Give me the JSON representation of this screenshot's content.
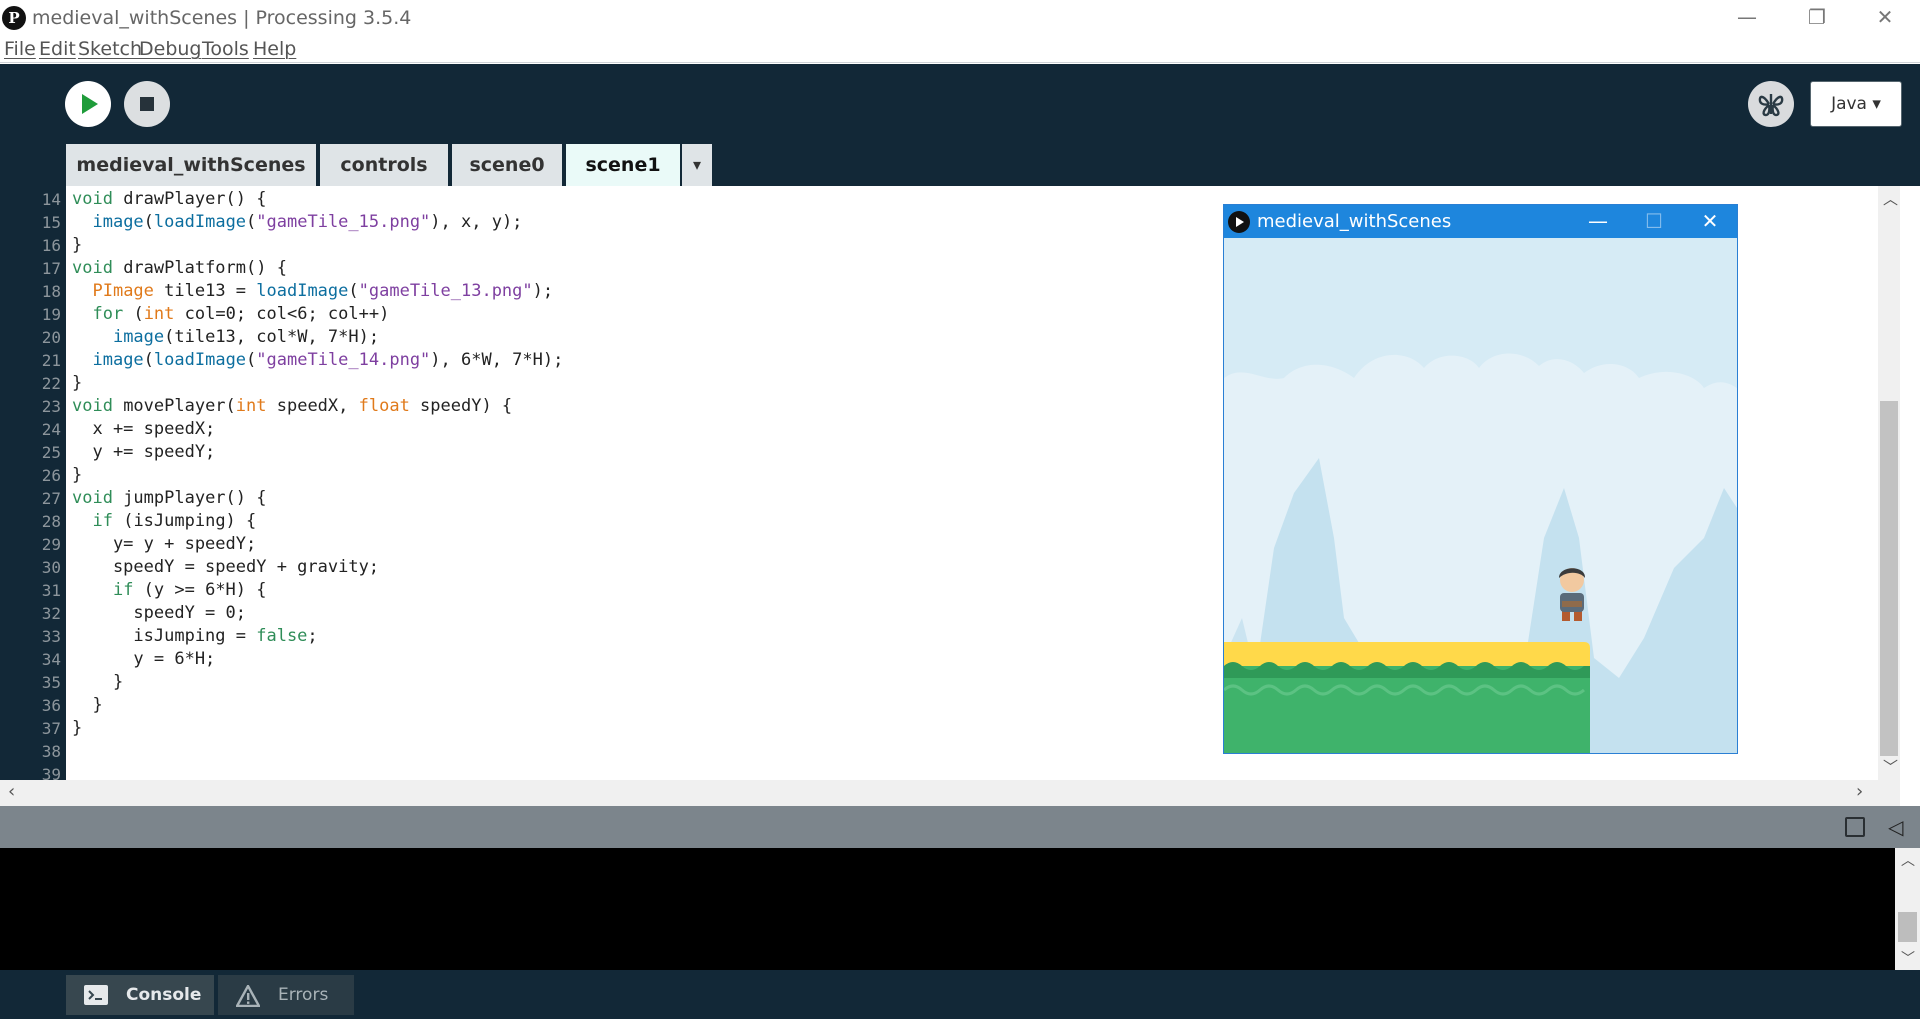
{
  "window": {
    "title": "medieval_withScenes | Processing 3.5.4",
    "app_icon_glyph": "P",
    "controls": {
      "minimize": "—",
      "restore": "❐",
      "close": "✕"
    }
  },
  "menu": [
    "File",
    "Edit",
    "Sketch",
    "Debug",
    "Tools",
    "Help"
  ],
  "toolbar": {
    "mode_label": "Java ▾",
    "debug_icon": "butterfly-icon"
  },
  "tabs": [
    {
      "label": "medieval_withScenes",
      "active": false
    },
    {
      "label": "controls",
      "active": false
    },
    {
      "label": "scene0",
      "active": false
    },
    {
      "label": "scene1",
      "active": true
    }
  ],
  "tab_menu_glyph": "▾",
  "editor": {
    "line_numbers": [
      "14",
      "15",
      "16",
      "17",
      "18",
      "19",
      "20",
      "21",
      "22",
      "23",
      "24",
      "25",
      "26",
      "27",
      "28",
      "29",
      "30",
      "31",
      "32",
      "33",
      "34",
      "35",
      "36",
      "37",
      "38",
      "39"
    ],
    "lines": [
      "void drawPlayer() {",
      "  image(loadImage(\"gameTile_15.png\"), x, y);",
      "}",
      "void drawPlatform() {",
      "  PImage tile13 = loadImage(\"gameTile_13.png\");",
      "  for (int col=0; col<6; col++)",
      "    image(tile13, col*W, 7*H);",
      "  image(loadImage(\"gameTile_14.png\"), 6*W, 7*H);",
      "}",
      "void movePlayer(int speedX, float speedY) {",
      "  x += speedX;",
      "  y += speedY;",
      "}",
      "void jumpPlayer() {",
      "  if (isJumping) {",
      "    y= y + speedY;",
      "    speedY = speedY + gravity;",
      "    if (y >= 6*H) {",
      "      speedY = 0;",
      "      isJumping = false;",
      "      y = 6*H;",
      "    }",
      "  }",
      "}",
      ""
    ]
  },
  "sketch_window": {
    "title": "medieval_withScenes",
    "controls": {
      "minimize": "—",
      "maximize": "☐",
      "close": "✕"
    },
    "colors": {
      "sky": "#d6ebf5",
      "cloud": "#e4f1f8",
      "mountain": "#c4e1ef",
      "grass_top": "#ffd94a",
      "grass": "#3fb36b"
    }
  },
  "console": {
    "tabs": [
      {
        "label": "Console",
        "icon": "terminal-icon"
      },
      {
        "label": "Errors",
        "icon": "warning-icon"
      }
    ]
  }
}
